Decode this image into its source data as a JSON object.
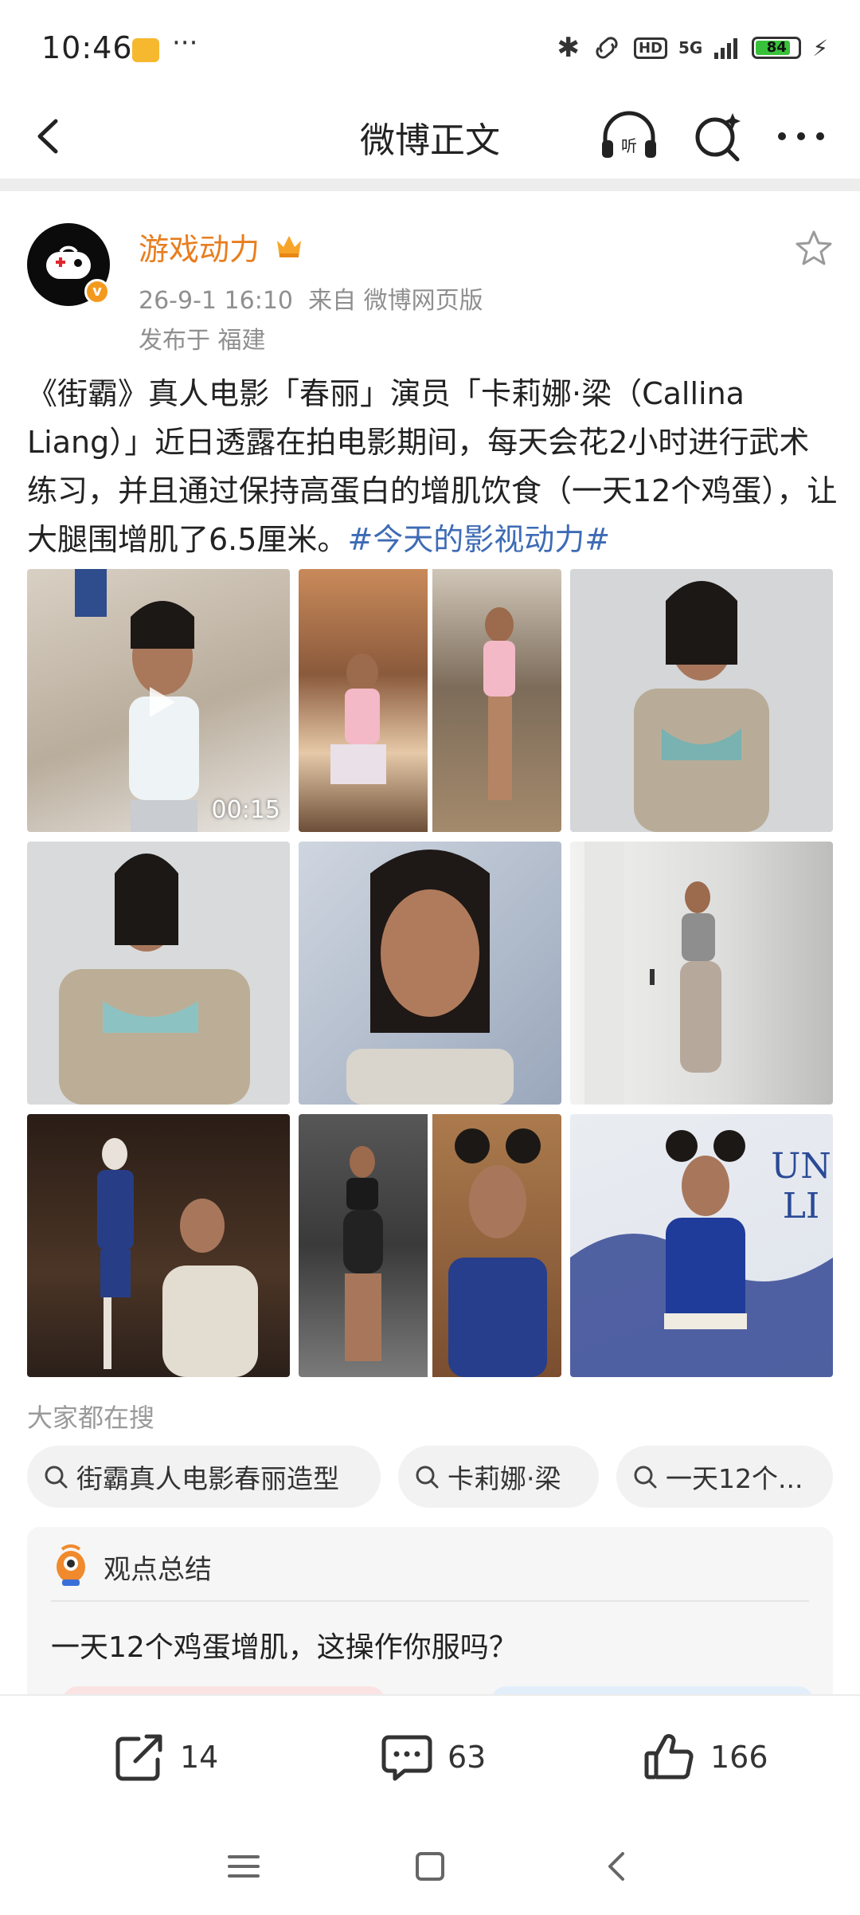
{
  "status_bar": {
    "time": "10:46",
    "more": "···",
    "network": "5G",
    "hd": "HD",
    "battery_level": 84,
    "battery_text": "84"
  },
  "nav": {
    "title": "微博正文",
    "icons": [
      "back-icon",
      "listen-icon",
      "ai-search-icon",
      "more-icon"
    ]
  },
  "post": {
    "author": "游戏动力",
    "time": "26-9-1 16:10",
    "source": "来自 微博网页版",
    "location": "发布于 福建",
    "text": "《街霸》真人电影「春丽」演员「卡莉娜·梁（Callina Liang）」近日透露在拍电影期间，每天会花2小时进行武术练习，并且通过保持高蛋白的增肌饮食（一天12个鸡蛋），让大腿围增肌了6.5厘米。",
    "hashtag": "#今天的影视动力#",
    "video_duration": "00:15"
  },
  "search": {
    "heading": "大家都在搜",
    "chips": [
      "街霸真人电影春丽造型",
      "卡莉娜·梁",
      "一天12个..."
    ]
  },
  "summary": {
    "title": "观点总结",
    "question": "一天12个鸡蛋增肌，这操作你服吗？"
  },
  "actions": {
    "repost": "14",
    "comment": "63",
    "like": "166"
  },
  "colors": {
    "username": "#e87e1f",
    "hashtag": "#3e6bb5",
    "meta": "#8f8f8f",
    "battery": "#38c13a"
  }
}
